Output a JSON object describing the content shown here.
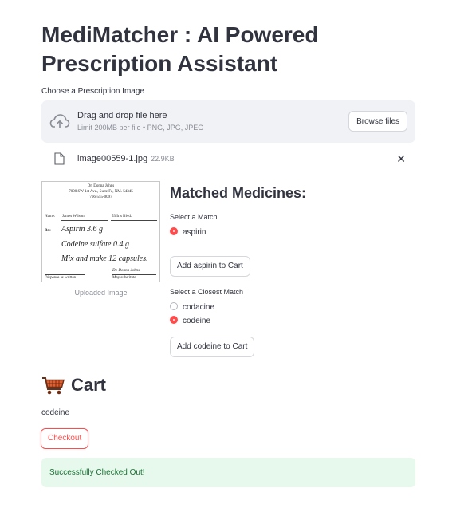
{
  "page": {
    "title": "MediMatcher : AI Powered Prescription Assistant"
  },
  "uploader": {
    "label": "Choose a Prescription Image",
    "drop_title": "Drag and drop file here",
    "drop_subtitle": "Limit 200MB per file • PNG, JPG, JPEG",
    "browse_label": "Browse files",
    "file": {
      "name": "image00559-1.jpg",
      "size": "22.9KB"
    }
  },
  "prescription": {
    "doctor": "Dr. Donna Johns",
    "address": "7000 SW 1st Ave., Suite Fe, NM. 54345",
    "phone": "766-555-0097",
    "name_label": "Name:",
    "patient": "James Wilson",
    "patient_address": "53 Iris Blvd.",
    "rx_label": "Rx:",
    "line1": "Aspirin 3.6 g",
    "line2": "Codeine sulfate 0.4 g",
    "line3": "Mix and make 12 capsules.",
    "signature": "Dr. Donna Johns",
    "dispense_label": "Dispense as written",
    "substitute_label": "May substitute",
    "caption": "Uploaded Image"
  },
  "matches": {
    "heading": "Matched Medicines:",
    "group1": {
      "label": "Select a Match",
      "options": [
        "aspirin"
      ],
      "selected": "aspirin",
      "button": "Add aspirin to Cart"
    },
    "group2": {
      "label": "Select a Closest Match",
      "options": [
        "codacine",
        "codeine"
      ],
      "selected": "codeine",
      "button": "Add codeine to Cart"
    }
  },
  "cart": {
    "title": "Cart",
    "icon": "shopping-cart-icon",
    "items": [
      "codeine"
    ],
    "checkout_label": "Checkout",
    "success_message": "Successfully Checked Out!"
  },
  "colors": {
    "accent": "#ff4b4b",
    "success_bg": "#e7f8ec",
    "success_text": "#177233"
  }
}
